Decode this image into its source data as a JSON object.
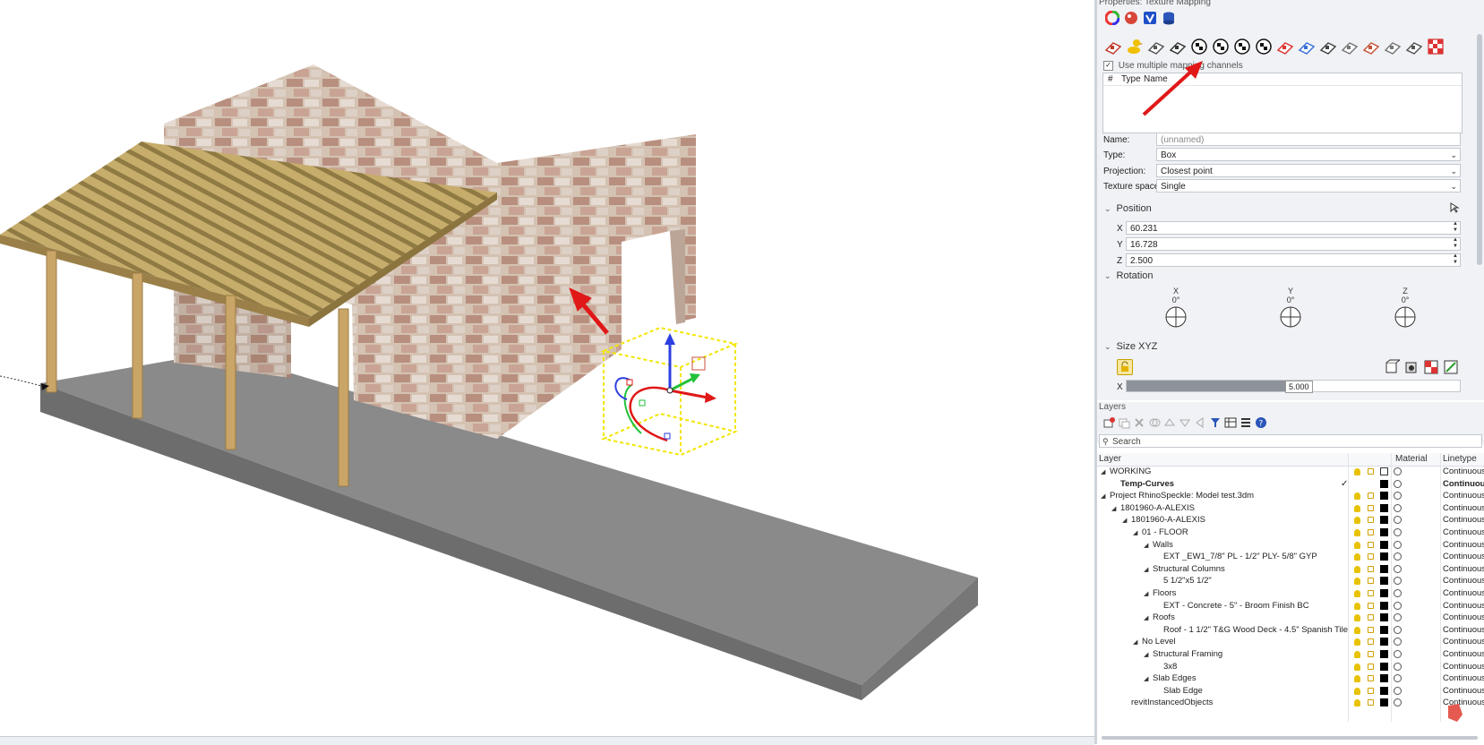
{
  "properties": {
    "panel_title": "Properties: Texture Mapping",
    "top_icons": [
      "color-wheel-icon",
      "material-ball-icon",
      "check-v-icon",
      "database-stack-icon"
    ],
    "toolbar_icons": [
      "mapping-icon",
      "duck-icon",
      "planar-map-icon",
      "planar-add-icon",
      "box-map-icon",
      "sphere-map-icon",
      "sphere-add-icon",
      "checker-ball-icon",
      "paint-drop-icon",
      "paint-brush-icon",
      "cylinder-map-icon",
      "custom-map-icon",
      "unwrap-icon",
      "surface-icon",
      "cage-icon",
      "checker-red-icon"
    ],
    "multi_channel_label": "Use multiple mapping channels",
    "table_cols": {
      "hash": "#",
      "type": "Type",
      "name": "Name"
    },
    "name_label": "Name:",
    "name_placeholder": "(unnamed)",
    "type_label": "Type:",
    "type_value": "Box",
    "projection_label": "Projection:",
    "projection_value": "Closest point",
    "texture_space_label": "Texture space:",
    "texture_space_value": "Single",
    "position_label": "Position",
    "pos_x_label": "X",
    "pos_x": "60.231",
    "pos_y_label": "Y",
    "pos_y": "16.728",
    "pos_z_label": "Z",
    "pos_z": "2.500",
    "rotation_label": "Rotation",
    "rot": [
      {
        "axis": "X",
        "value": "0°"
      },
      {
        "axis": "Y",
        "value": "0°"
      },
      {
        "axis": "Z",
        "value": "0°"
      }
    ],
    "size_label": "Size XYZ",
    "size_x_label": "X",
    "size_x_value": "5.000",
    "size_x_fraction": 0.48
  },
  "layers": {
    "title": "Layers",
    "search_placeholder": "Search",
    "columns": {
      "layer": "Layer",
      "material": "Material",
      "linetype": "Linetype"
    },
    "rows": [
      {
        "name": "WORKING",
        "indent": 0,
        "expand": true,
        "swatch": "white",
        "linetype": "Continuous",
        "bold": false,
        "current": false,
        "icons": true
      },
      {
        "name": "Temp-Curves",
        "indent": 1,
        "expand": false,
        "swatch": "black",
        "linetype": "Continuous",
        "bold": true,
        "current": true,
        "icons": false
      },
      {
        "name": "Project RhinoSpeckle: Model test.3dm",
        "indent": 0,
        "expand": true,
        "swatch": "black",
        "linetype": "Continuous",
        "bold": false,
        "current": false,
        "icons": true
      },
      {
        "name": "1801960-A-ALEXIS",
        "indent": 1,
        "expand": true,
        "swatch": "black",
        "linetype": "Continuous",
        "bold": false,
        "current": false,
        "icons": true
      },
      {
        "name": "1801960-A-ALEXIS",
        "indent": 2,
        "expand": true,
        "swatch": "black",
        "linetype": "Continuous",
        "bold": false,
        "current": false,
        "icons": true
      },
      {
        "name": "01 - FLOOR",
        "indent": 3,
        "expand": true,
        "swatch": "black",
        "linetype": "Continuous",
        "bold": false,
        "current": false,
        "icons": true
      },
      {
        "name": "Walls",
        "indent": 4,
        "expand": true,
        "swatch": "black",
        "linetype": "Continuous",
        "bold": false,
        "current": false,
        "icons": true
      },
      {
        "name": "EXT _EW1_7/8\" PL - 1/2\" PLY- 5/8\" GYP",
        "indent": 5,
        "expand": false,
        "swatch": "black",
        "linetype": "Continuous",
        "bold": false,
        "current": false,
        "icons": true
      },
      {
        "name": "Structural Columns",
        "indent": 4,
        "expand": true,
        "swatch": "black",
        "linetype": "Continuous",
        "bold": false,
        "current": false,
        "icons": true
      },
      {
        "name": "5 1/2\"x5 1/2\"",
        "indent": 5,
        "expand": false,
        "swatch": "black",
        "linetype": "Continuous",
        "bold": false,
        "current": false,
        "icons": true
      },
      {
        "name": "Floors",
        "indent": 4,
        "expand": true,
        "swatch": "black",
        "linetype": "Continuous",
        "bold": false,
        "current": false,
        "icons": true
      },
      {
        "name": "EXT - Concrete - 5\" - Broom Finish BC",
        "indent": 5,
        "expand": false,
        "swatch": "black",
        "linetype": "Continuous",
        "bold": false,
        "current": false,
        "icons": true
      },
      {
        "name": "Roofs",
        "indent": 4,
        "expand": true,
        "swatch": "black",
        "linetype": "Continuous",
        "bold": false,
        "current": false,
        "icons": true
      },
      {
        "name": "Roof - 1 1/2\" T&G Wood Deck - 4.5\" Spanish Tile",
        "indent": 5,
        "expand": false,
        "swatch": "black",
        "linetype": "Continuous",
        "bold": false,
        "current": false,
        "icons": true
      },
      {
        "name": "No Level",
        "indent": 3,
        "expand": true,
        "swatch": "black",
        "linetype": "Continuous",
        "bold": false,
        "current": false,
        "icons": true
      },
      {
        "name": "Structural Framing",
        "indent": 4,
        "expand": true,
        "swatch": "black",
        "linetype": "Continuous",
        "bold": false,
        "current": false,
        "icons": true
      },
      {
        "name": "3x8",
        "indent": 5,
        "expand": false,
        "swatch": "black",
        "linetype": "Continuous",
        "bold": false,
        "current": false,
        "icons": true
      },
      {
        "name": "Slab Edges",
        "indent": 4,
        "expand": true,
        "swatch": "black",
        "linetype": "Continuous",
        "bold": false,
        "current": false,
        "icons": true
      },
      {
        "name": "Slab Edge",
        "indent": 5,
        "expand": false,
        "swatch": "black",
        "linetype": "Continuous",
        "bold": false,
        "current": false,
        "icons": true
      },
      {
        "name": "revitInstancedObjects",
        "indent": 2,
        "expand": false,
        "swatch": "black",
        "linetype": "Continuous",
        "bold": false,
        "current": false,
        "icons": true
      }
    ]
  },
  "colors": {
    "accent_arrow": "#e01818",
    "gizmo_yellow": "#f2e600",
    "wall_brick": "#c9b6a6",
    "roof_wood": "#b59a5a",
    "slab": "#8c8c8c"
  }
}
